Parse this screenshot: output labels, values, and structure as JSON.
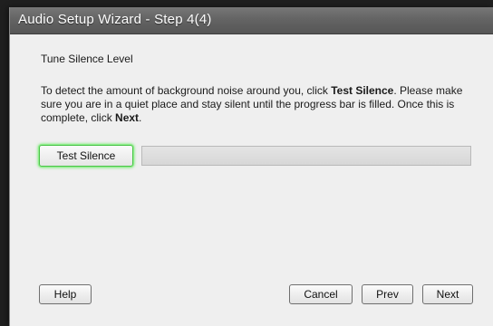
{
  "window": {
    "title": "Audio Setup Wizard - Step 4(4)"
  },
  "section": {
    "heading": "Tune Silence Level"
  },
  "instructions": {
    "part1": "To detect the amount of background noise around you, click ",
    "test_silence_bold": "Test Silence",
    "part2": ". Please make sure you are in a quiet place and stay silent until the progress bar is filled. Once this is complete, click ",
    "next_bold": "Next",
    "part3": "."
  },
  "test": {
    "button_label": "Test Silence",
    "progress_fraction": 0
  },
  "footer": {
    "help_label": "Help",
    "cancel_label": "Cancel",
    "prev_label": "Prev",
    "next_label": "Next"
  }
}
